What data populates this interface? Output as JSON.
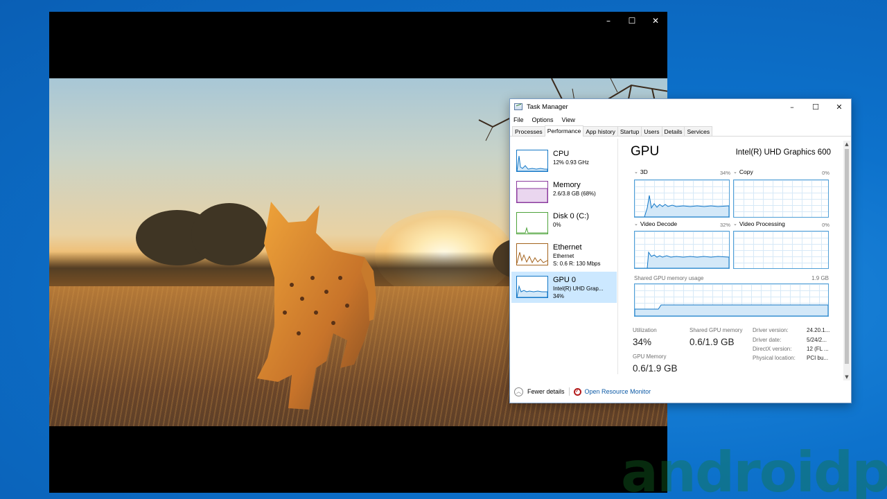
{
  "player": {
    "controls": {
      "minimize": "–",
      "maximize": "☐",
      "close": "✕"
    }
  },
  "task_manager": {
    "title": "Task Manager",
    "window_controls": {
      "minimize": "–",
      "maximize": "☐",
      "close": "✕"
    },
    "menu": [
      "File",
      "Options",
      "View"
    ],
    "tabs": [
      "Processes",
      "Performance",
      "App history",
      "Startup",
      "Users",
      "Details",
      "Services"
    ],
    "active_tab": "Performance",
    "sidebar": [
      {
        "name": "CPU",
        "line1": "12% 0.93 GHz",
        "line2": "",
        "color": "#1176c6"
      },
      {
        "name": "Memory",
        "line1": "2.6/3.8 GB (68%)",
        "line2": "",
        "color": "#8b3a9e"
      },
      {
        "name": "Disk 0 (C:)",
        "line1": "0%",
        "line2": "",
        "color": "#4da33a"
      },
      {
        "name": "Ethernet",
        "line1": "Ethernet",
        "line2": "S: 0.6  R: 130 Mbps",
        "color": "#a3621b"
      },
      {
        "name": "GPU 0",
        "line1": "Intel(R) UHD Grap...",
        "line2": "34%",
        "color": "#1176c6"
      }
    ],
    "selected_index": 4,
    "gpu": {
      "heading": "GPU",
      "model": "Intel(R) UHD Graphics 600",
      "engines": [
        {
          "label": "3D",
          "pct": "34%"
        },
        {
          "label": "Copy",
          "pct": "0%"
        },
        {
          "label": "Video Decode",
          "pct": "32%"
        },
        {
          "label": "Video Processing",
          "pct": "0%"
        }
      ],
      "shared_memory_label": "Shared GPU memory usage",
      "shared_memory_max": "1.9 GB",
      "stats": {
        "utilization_label": "Utilization",
        "utilization_value": "34%",
        "shared_label": "Shared GPU memory",
        "shared_value": "0.6/1.9 GB",
        "gpu_memory_label": "GPU Memory",
        "gpu_memory_value": "0.6/1.9 GB"
      },
      "info": [
        {
          "key": "Driver version:",
          "value": "24.20.1..."
        },
        {
          "key": "Driver date:",
          "value": "5/24/2..."
        },
        {
          "key": "DirectX version:",
          "value": "12 (FL ..."
        },
        {
          "key": "Physical location:",
          "value": "PCI bu..."
        }
      ]
    },
    "footer": {
      "fewer_details": "Fewer details",
      "open_resource_monitor": "Open Resource Monitor"
    },
    "accent_color": "#1176c6",
    "selected_bg": "#cce8ff"
  },
  "watermark": "androidpc"
}
